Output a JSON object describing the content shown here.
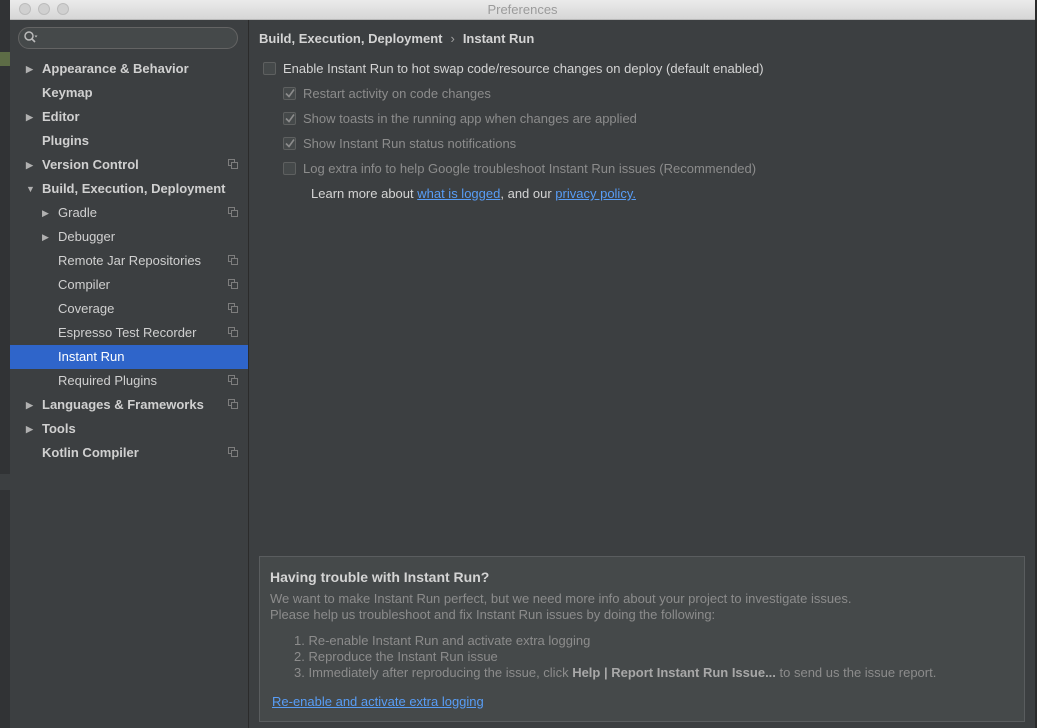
{
  "window": {
    "title": "Preferences"
  },
  "sidebar": {
    "search_placeholder": "",
    "items": [
      {
        "label": "Appearance & Behavior",
        "bold": true,
        "arrow": "right",
        "indent": 0,
        "project_icon": false
      },
      {
        "label": "Keymap",
        "bold": true,
        "arrow": "none",
        "indent": 0,
        "project_icon": false
      },
      {
        "label": "Editor",
        "bold": true,
        "arrow": "right",
        "indent": 0,
        "project_icon": false
      },
      {
        "label": "Plugins",
        "bold": true,
        "arrow": "none",
        "indent": 0,
        "project_icon": false
      },
      {
        "label": "Version Control",
        "bold": true,
        "arrow": "right",
        "indent": 0,
        "project_icon": true
      },
      {
        "label": "Build, Execution, Deployment",
        "bold": true,
        "arrow": "down",
        "indent": 0,
        "project_icon": false
      },
      {
        "label": "Gradle",
        "bold": false,
        "arrow": "right",
        "indent": 1,
        "project_icon": true
      },
      {
        "label": "Debugger",
        "bold": false,
        "arrow": "right",
        "indent": 1,
        "project_icon": false
      },
      {
        "label": "Remote Jar Repositories",
        "bold": false,
        "arrow": "none",
        "indent": 1,
        "project_icon": true
      },
      {
        "label": "Compiler",
        "bold": false,
        "arrow": "none",
        "indent": 1,
        "project_icon": true
      },
      {
        "label": "Coverage",
        "bold": false,
        "arrow": "none",
        "indent": 1,
        "project_icon": true
      },
      {
        "label": "Espresso Test Recorder",
        "bold": false,
        "arrow": "none",
        "indent": 1,
        "project_icon": true
      },
      {
        "label": "Instant Run",
        "bold": false,
        "arrow": "none",
        "indent": 1,
        "project_icon": false,
        "selected": true
      },
      {
        "label": "Required Plugins",
        "bold": false,
        "arrow": "none",
        "indent": 1,
        "project_icon": true
      },
      {
        "label": "Languages & Frameworks",
        "bold": true,
        "arrow": "right",
        "indent": 0,
        "project_icon": true
      },
      {
        "label": "Tools",
        "bold": true,
        "arrow": "right",
        "indent": 0,
        "project_icon": false
      },
      {
        "label": "Kotlin Compiler",
        "bold": true,
        "arrow": "none",
        "indent": 0,
        "project_icon": true
      }
    ]
  },
  "main": {
    "breadcrumb": {
      "parent": "Build, Execution, Deployment",
      "separator": "›",
      "current": "Instant Run"
    },
    "enable_checkbox": {
      "label": "Enable Instant Run to hot swap code/resource changes on deploy (default enabled)",
      "checked": false
    },
    "options": [
      {
        "label": "Restart activity on code changes",
        "checked": true
      },
      {
        "label": "Show toasts in the running app when changes are applied",
        "checked": true
      },
      {
        "label": "Show Instant Run status notifications",
        "checked": true
      },
      {
        "label": "Log extra info to help Google troubleshoot Instant Run issues (Recommended)",
        "checked": false
      }
    ],
    "learn_more": {
      "prefix": "Learn more about ",
      "link1": "what is logged",
      "middle": ", and our ",
      "link2": "privacy policy."
    },
    "trouble": {
      "title": "Having trouble with Instant Run?",
      "line1": "We want to make Instant Run perfect, but we need more info about your project to investigate issues.",
      "line2": "Please help us troubleshoot and fix Instant Run issues by doing the following:",
      "step1": "1.  Re-enable Instant Run and activate extra logging",
      "step2": "2.  Reproduce the Instant Run issue",
      "step3_prefix": "3.  Immediately after reproducing the issue, click ",
      "step3_bold": "Help | Report Instant Run Issue...",
      "step3_suffix": " to send us the issue report.",
      "link": "Re-enable and activate extra logging"
    }
  },
  "colors": {
    "sidebar_bg": "#3c3f41",
    "selection": "#2f65ca",
    "link": "#589df6",
    "panel_bg": "#45494a"
  }
}
